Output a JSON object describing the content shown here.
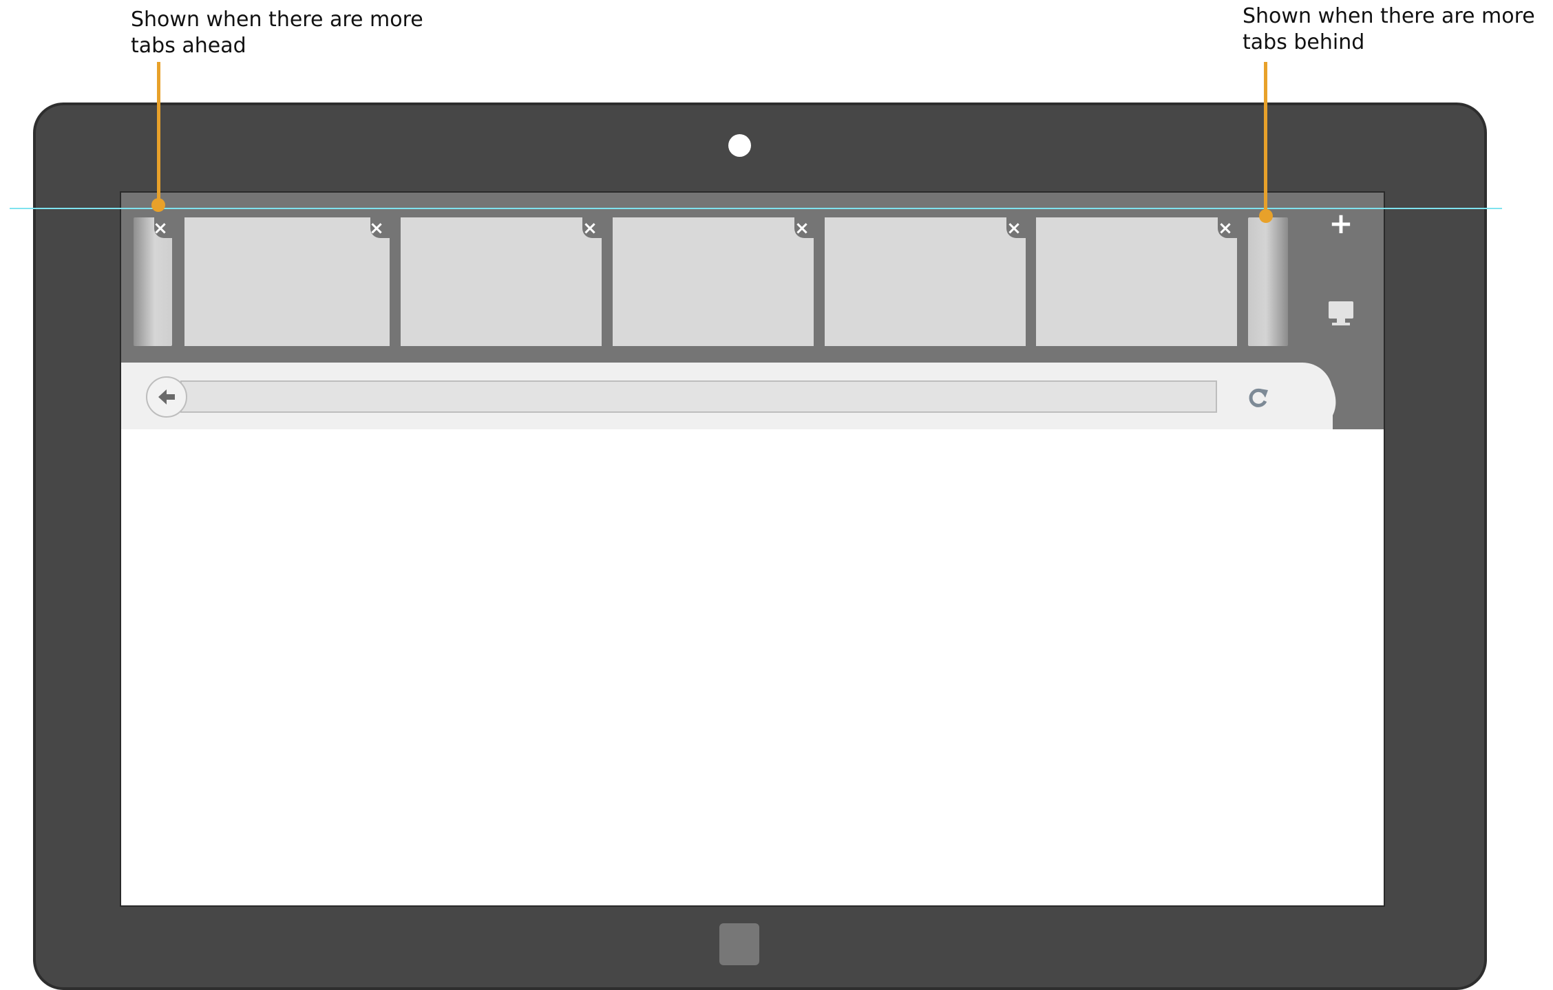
{
  "annotations": {
    "left_note": "Shown when there are more tabs ahead",
    "right_note": "Shown when there are more tabs behind"
  },
  "colors": {
    "tablet_bezel": "#474747",
    "tabstrip": "#757575",
    "tab": "#d9d9d9",
    "navbar": "#f0f0f0",
    "address_bar": "#e3e3e3",
    "leader": "#e8a12a",
    "guide_line": "#7fe3ef"
  },
  "tabstrip": {
    "tabs": [
      {
        "close_label": "×"
      },
      {
        "close_label": "×"
      },
      {
        "close_label": "×"
      },
      {
        "close_label": "×"
      },
      {
        "close_label": "×"
      }
    ],
    "partial_left_close_label": "×",
    "new_tab_label": "+",
    "new_tab_icon": "plus-icon",
    "desktop_icon": "monitor-icon"
  },
  "navbar": {
    "back_icon": "arrow-left-icon",
    "address_value": "",
    "reload_icon": "reload-icon"
  }
}
